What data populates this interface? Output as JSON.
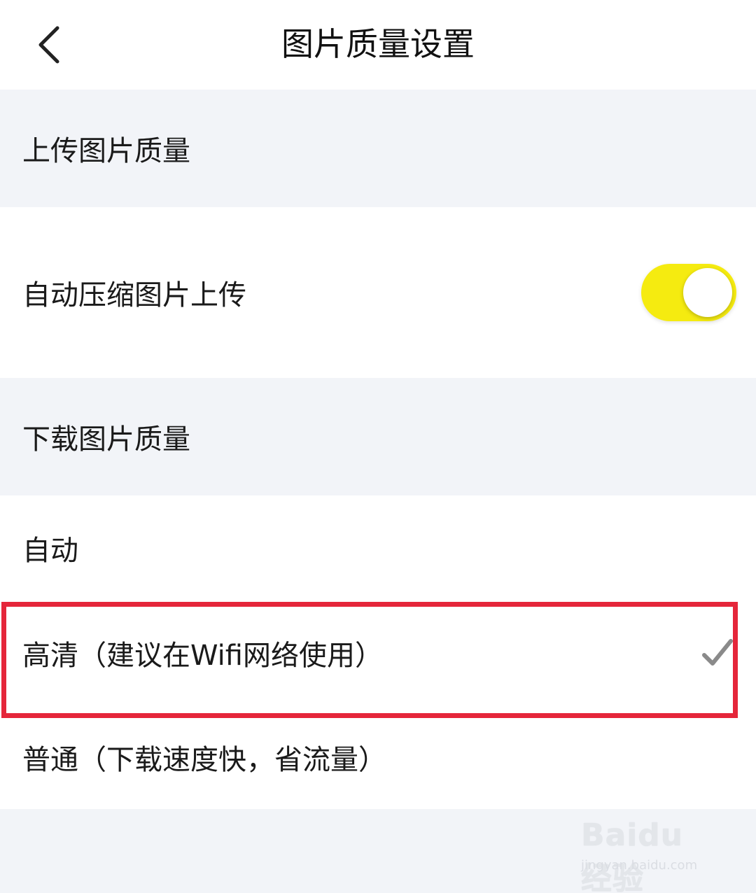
{
  "header": {
    "title": "图片质量设置",
    "back_icon": "chevron-left-icon"
  },
  "upload_section": {
    "title": "上传图片质量",
    "auto_compress": {
      "label": "自动压缩图片上传",
      "enabled": true,
      "toggle_color": "#f5eb10"
    }
  },
  "download_section": {
    "title": "下载图片质量",
    "options": [
      {
        "label": "自动",
        "selected": false
      },
      {
        "label": "高清（建议在Wifi网络使用）",
        "selected": true
      },
      {
        "label": "普通（下载速度快，省流量）",
        "selected": false
      }
    ]
  },
  "annotation": {
    "highlight_color": "#e5263a"
  },
  "watermark": {
    "logo": "Baidu经验",
    "url": "jingyan.baidu.com"
  }
}
